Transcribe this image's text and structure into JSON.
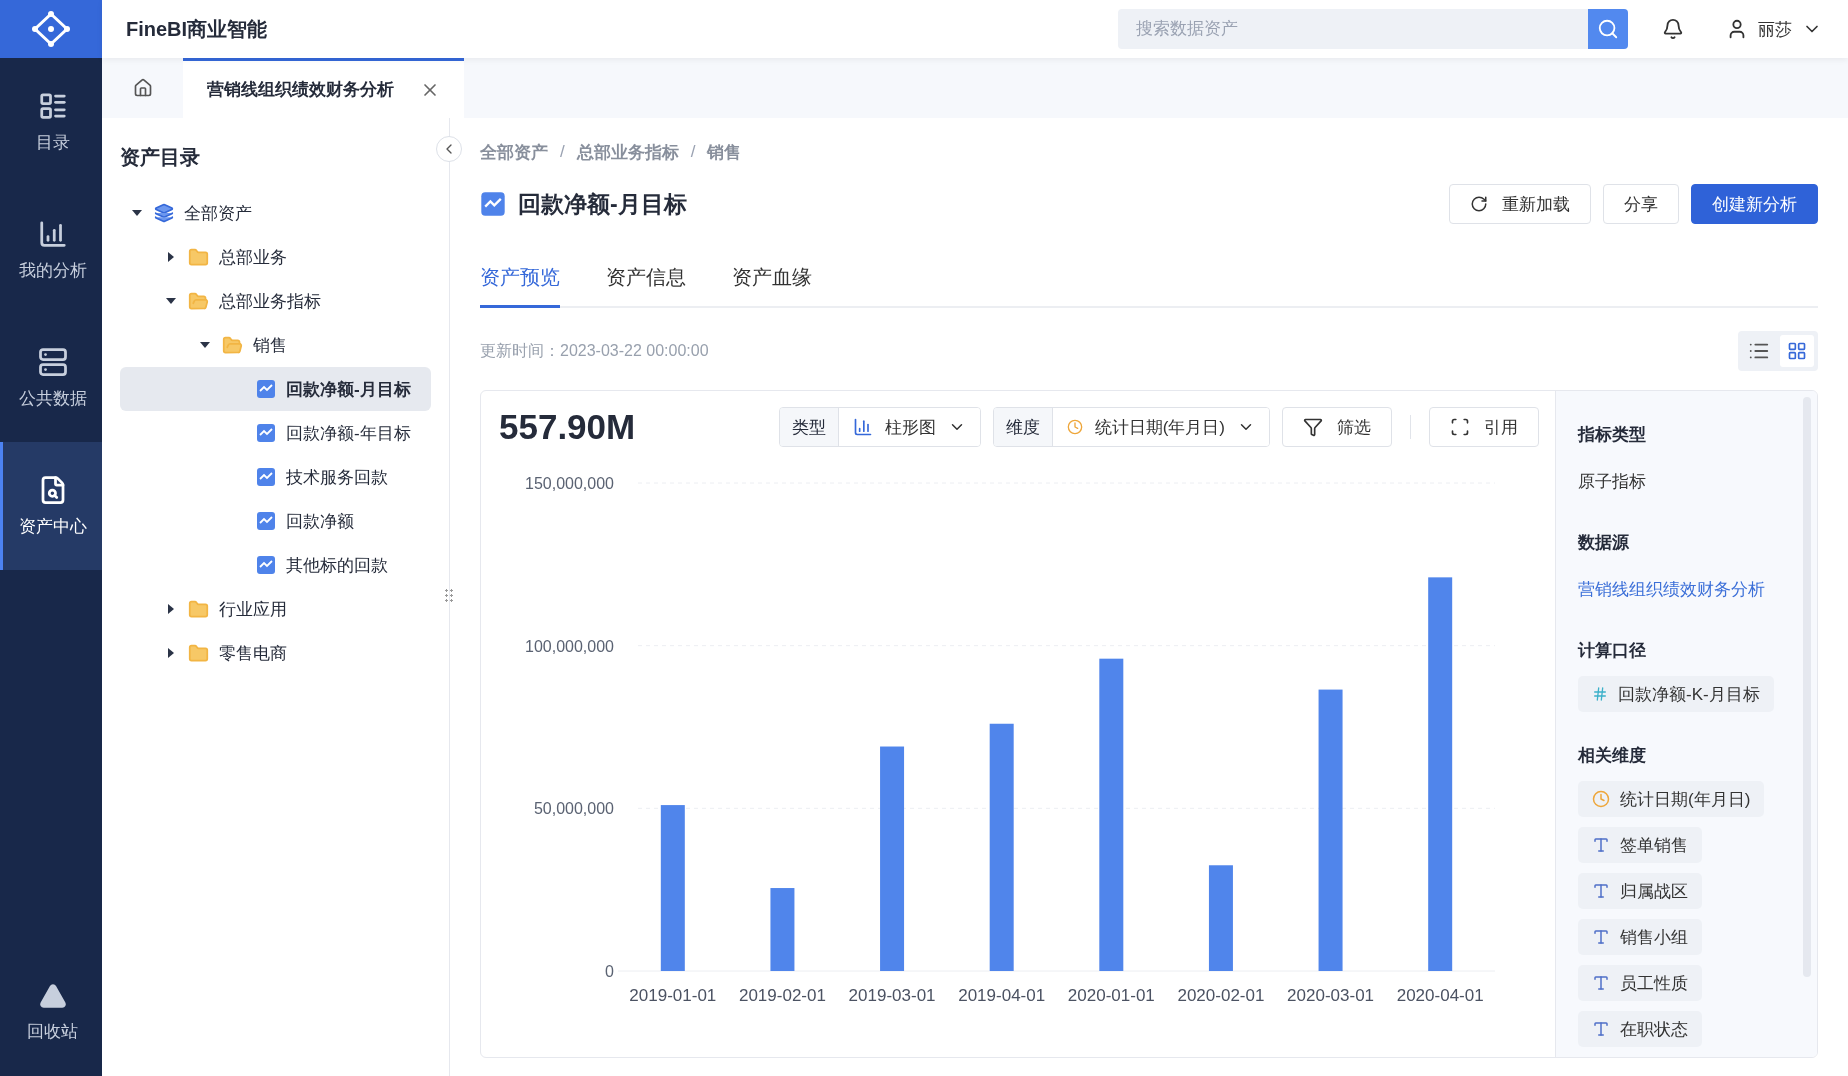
{
  "app": {
    "title": "FineBI商业智能"
  },
  "search": {
    "placeholder": "搜索数据资产"
  },
  "user": {
    "name": "丽莎"
  },
  "nav": [
    {
      "label": "目录",
      "selected": false
    },
    {
      "label": "我的分析",
      "selected": false
    },
    {
      "label": "公共数据",
      "selected": false
    },
    {
      "label": "资产中心",
      "selected": true
    }
  ],
  "nav_bottom": {
    "label": "回收站"
  },
  "open_tabs": [
    {
      "label": "营销线组织绩效财务分析",
      "selected": true
    }
  ],
  "sidebar": {
    "title": "资产目录",
    "tree": [
      {
        "label": "全部资产",
        "kind": "root",
        "expanded": true,
        "selected": false,
        "children": [
          {
            "label": "总部业务",
            "kind": "folder",
            "expanded": false,
            "selected": false
          },
          {
            "label": "总部业务指标",
            "kind": "folder",
            "expanded": true,
            "selected": false,
            "children": [
              {
                "label": "销售",
                "kind": "folder",
                "expanded": true,
                "selected": false,
                "children": [
                  {
                    "label": "回款净额-月目标",
                    "kind": "metric",
                    "selected": true
                  },
                  {
                    "label": "回款净额-年目标",
                    "kind": "metric",
                    "selected": false
                  },
                  {
                    "label": "技术服务回款",
                    "kind": "metric",
                    "selected": false
                  },
                  {
                    "label": "回款净额",
                    "kind": "metric",
                    "selected": false
                  },
                  {
                    "label": "其他标的回款",
                    "kind": "metric",
                    "selected": false
                  }
                ]
              }
            ]
          },
          {
            "label": "行业应用",
            "kind": "folder",
            "expanded": false,
            "selected": false
          },
          {
            "label": "零售电商",
            "kind": "folder",
            "expanded": false,
            "selected": false
          }
        ]
      }
    ]
  },
  "breadcrumb": {
    "separator": "/",
    "items": [
      "全部资产",
      "总部业务指标",
      "销售"
    ]
  },
  "asset": {
    "title": "回款净额-月目标"
  },
  "actions": [
    {
      "label": "重新加载",
      "kind": "reload"
    },
    {
      "label": "分享",
      "kind": "plain"
    },
    {
      "label": "创建新分析",
      "kind": "primary"
    }
  ],
  "tabs": [
    {
      "label": "资产预览",
      "selected": true
    },
    {
      "label": "资产信息",
      "selected": false
    },
    {
      "label": "资产血缘",
      "selected": false
    }
  ],
  "updated": {
    "label": "更新时间：",
    "value": "2023-03-22 00:00:00"
  },
  "view_modes": [
    {
      "kind": "list",
      "selected": false
    },
    {
      "kind": "grid",
      "selected": true
    }
  ],
  "card": {
    "total": "557.90M",
    "type_control": {
      "label": "类型",
      "value": "柱形图"
    },
    "dimension_control": {
      "label": "维度",
      "value": "统计日期(年月日)"
    },
    "filter": "筛选",
    "cite": "引用",
    "chart_data": {
      "type": "bar",
      "categories": [
        "2019-01-01",
        "2019-02-01",
        "2019-03-01",
        "2019-04-01",
        "2020-01-01",
        "2020-02-01",
        "2020-03-01",
        "2020-04-01"
      ],
      "series": [
        {
          "color": "#5085eb",
          "values": [
            51000000,
            25500000,
            69000000,
            76000000,
            96000000,
            32500000,
            86500000,
            121000000
          ]
        }
      ],
      "ylim": [
        0,
        150000000
      ],
      "yticks": [
        {
          "value": 0,
          "label": "0"
        },
        {
          "value": 50000000,
          "label": "50,000,000"
        },
        {
          "value": 100000000,
          "label": "100,000,000"
        },
        {
          "value": 150000000,
          "label": "150,000,000"
        }
      ]
    }
  },
  "details": [
    {
      "title": "指标类型",
      "kind": "text",
      "value": "原子指标"
    },
    {
      "title": "数据源",
      "kind": "link",
      "value": "营销线组织绩效财务分析"
    },
    {
      "title": "计算口径",
      "kind": "tags",
      "tags": [
        {
          "label": "回款净额-K-月目标",
          "kind": "measure"
        }
      ]
    },
    {
      "title": "相关维度",
      "kind": "tags",
      "tags": [
        {
          "label": "统计日期(年月日)",
          "kind": "date"
        },
        {
          "label": "签单销售",
          "kind": "text"
        },
        {
          "label": "归属战区",
          "kind": "text"
        },
        {
          "label": "销售小组",
          "kind": "text"
        },
        {
          "label": "员工性质",
          "kind": "text"
        },
        {
          "label": "在职状态",
          "kind": "text"
        }
      ]
    }
  ]
}
